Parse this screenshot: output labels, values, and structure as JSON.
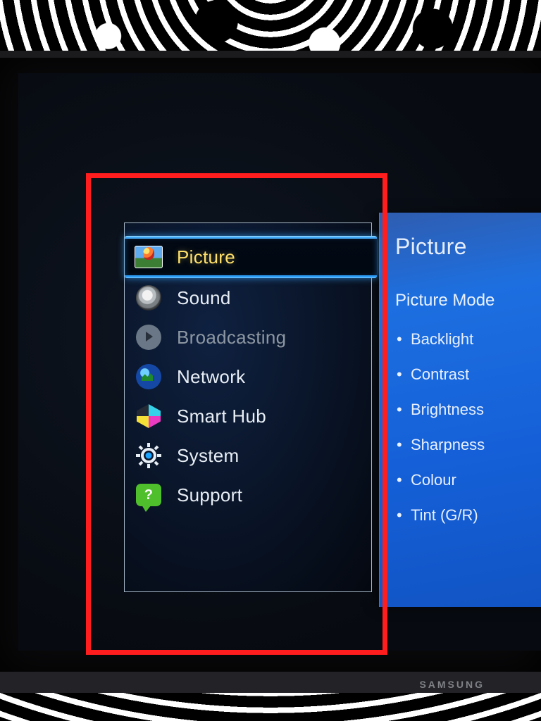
{
  "brand": "SAMSUNG",
  "menu": {
    "items": [
      {
        "key": "picture",
        "label": "Picture",
        "icon": "picture-icon",
        "selected": true,
        "disabled": false
      },
      {
        "key": "sound",
        "label": "Sound",
        "icon": "sound-icon",
        "selected": false,
        "disabled": false
      },
      {
        "key": "broadcasting",
        "label": "Broadcasting",
        "icon": "broadcasting-icon",
        "selected": false,
        "disabled": true
      },
      {
        "key": "network",
        "label": "Network",
        "icon": "network-icon",
        "selected": false,
        "disabled": false
      },
      {
        "key": "smarthub",
        "label": "Smart Hub",
        "icon": "smarthub-icon",
        "selected": false,
        "disabled": false
      },
      {
        "key": "system",
        "label": "System",
        "icon": "system-icon",
        "selected": false,
        "disabled": false
      },
      {
        "key": "support",
        "label": "Support",
        "icon": "support-icon",
        "selected": false,
        "disabled": false
      }
    ]
  },
  "submenu": {
    "title": "Picture",
    "section": "Picture Mode",
    "items": [
      "Backlight",
      "Contrast",
      "Brightness",
      "Sharpness",
      "Colour",
      "Tint (G/R)"
    ]
  },
  "highlight_box_label": "main-menu-panel"
}
